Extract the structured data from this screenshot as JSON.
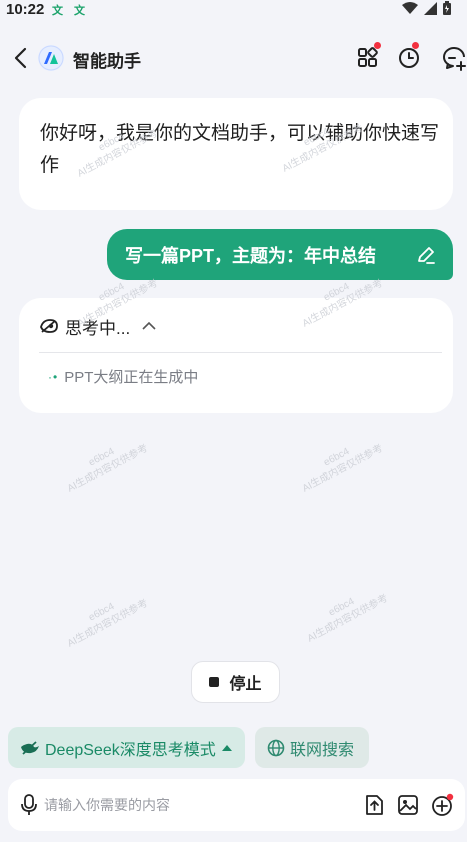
{
  "status_bar": {
    "time": "10:22",
    "app_icons": [
      "文",
      "文"
    ],
    "icons": [
      "wifi-icon",
      "signal-icon",
      "battery-icon"
    ]
  },
  "header": {
    "title": "智能助手",
    "icons": [
      "back-icon",
      "logo-icon",
      "apps-grid-icon",
      "history-clock-icon",
      "new-chat-icon"
    ]
  },
  "messages": {
    "assistant_greeting": "你好呀，我是你的文档助手，可以辅助你快速写作",
    "user_prompt": "写一篇PPT，主题为：年中总结"
  },
  "thinking": {
    "label": "思考中...",
    "progress_text": "PPT大纲正在生成中",
    "dots": "·•"
  },
  "stop_button": {
    "label": "停止"
  },
  "modes": {
    "deep_think_label": "DeepSeek深度思考模式",
    "web_search_label": "联网搜索"
  },
  "input": {
    "placeholder": "请输入你需要的内容",
    "value": ""
  },
  "watermark": {
    "line1": "e6bc4",
    "line2": "AI生成内容仅供参考"
  },
  "colors": {
    "accent": "#1fa47a",
    "chip_bg": "#d7ebe6",
    "background": "#f3f4f9",
    "badge": "#f2303f"
  }
}
